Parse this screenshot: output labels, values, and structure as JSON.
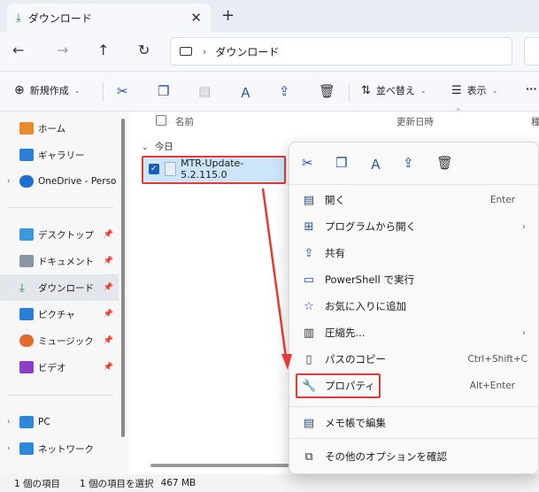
{
  "tab": {
    "title": "ダウンロード",
    "close_glyph": "✕",
    "new_glyph": "+"
  },
  "address": {
    "crumb": "ダウンロード",
    "sep": "›"
  },
  "toolbar": {
    "new_label": "新規作成",
    "sort_label": "並べ替え",
    "view_label": "表示",
    "more": "···"
  },
  "sidebar": {
    "items": [
      {
        "label": "ホーム"
      },
      {
        "label": "ギャラリー"
      },
      {
        "label": "OneDrive - Perso"
      },
      {
        "label": "デスクトップ"
      },
      {
        "label": "ドキュメント"
      },
      {
        "label": "ダウンロード"
      },
      {
        "label": "ピクチャ"
      },
      {
        "label": "ミュージック"
      },
      {
        "label": "ビデオ"
      },
      {
        "label": "PC"
      },
      {
        "label": "ネットワーク"
      }
    ]
  },
  "columns": {
    "name": "名前",
    "date": "更新日時",
    "type": "種"
  },
  "group": {
    "label": "今日"
  },
  "file": {
    "name": "MTR-Update-5.2.115.0"
  },
  "context_menu": {
    "items": [
      {
        "label": "開く",
        "shortcut": "Enter"
      },
      {
        "label": "プログラムから開く"
      },
      {
        "label": "共有"
      },
      {
        "label": "PowerShell で実行"
      },
      {
        "label": "お気に入りに追加"
      },
      {
        "label": "圧縮先..."
      },
      {
        "label": "パスのコピー",
        "shortcut": "Ctrl+Shift+C"
      },
      {
        "label": "プロパティ",
        "shortcut": "Alt+Enter"
      },
      {
        "label": "メモ帳で編集"
      },
      {
        "label": "その他のオプションを確認"
      }
    ]
  },
  "status": {
    "count": "1 個の項目",
    "selected": "1 個の項目を選択",
    "size": "467 MB"
  },
  "colors": {
    "highlight": "#e53935",
    "accent": "#1a5fb4",
    "selection": "#cde5fb"
  }
}
